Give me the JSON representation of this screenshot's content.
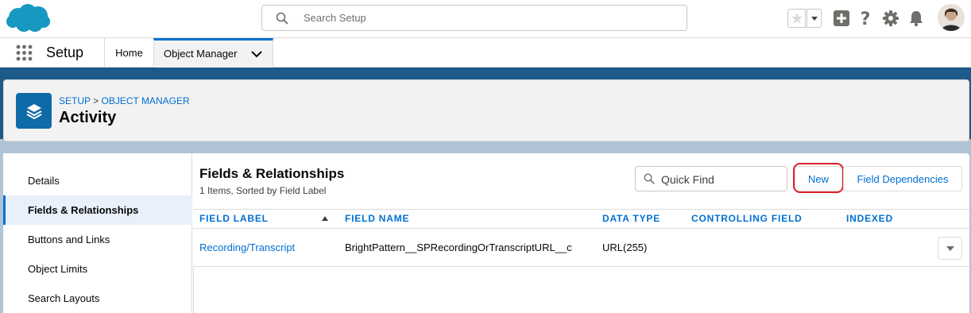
{
  "header": {
    "search_placeholder": "Search Setup"
  },
  "nav": {
    "app_name": "Setup",
    "home_tab": "Home",
    "object_manager_tab": "Object Manager"
  },
  "page_header": {
    "breadcrumb_setup": "SETUP",
    "breadcrumb_separator": ">",
    "breadcrumb_object_manager": "OBJECT MANAGER",
    "title": "Activity"
  },
  "sidebar": {
    "items": [
      {
        "label": "Details"
      },
      {
        "label": "Fields & Relationships"
      },
      {
        "label": "Buttons and Links"
      },
      {
        "label": "Object Limits"
      },
      {
        "label": "Search Layouts"
      }
    ]
  },
  "content": {
    "title": "Fields & Relationships",
    "subtitle": "1 Items, Sorted by Field Label",
    "quick_find_placeholder": "Quick Find",
    "new_button": "New",
    "field_dependencies_button": "Field Dependencies"
  },
  "table": {
    "columns": [
      "FIELD LABEL",
      "FIELD NAME",
      "DATA TYPE",
      "CONTROLLING FIELD",
      "INDEXED"
    ],
    "rows": [
      {
        "field_label": "Recording/Transcript",
        "field_name": "BrightPattern__SPRecordingOrTranscriptURL__c",
        "data_type": "URL(255)",
        "controlling_field": "",
        "indexed": ""
      }
    ]
  },
  "colors": {
    "brand_blue": "#0070d2",
    "highlight_red": "#e01f26",
    "salesforce_cloud": "#1798c1"
  },
  "icons": {
    "logo": "salesforce-cloud-logo",
    "search": "search-icon",
    "favorite": "star-icon",
    "add": "plus-icon",
    "help": "question-icon",
    "settings": "gear-icon",
    "notifications": "bell-icon",
    "app_launcher": "waffle-icon",
    "object": "layers-icon"
  }
}
